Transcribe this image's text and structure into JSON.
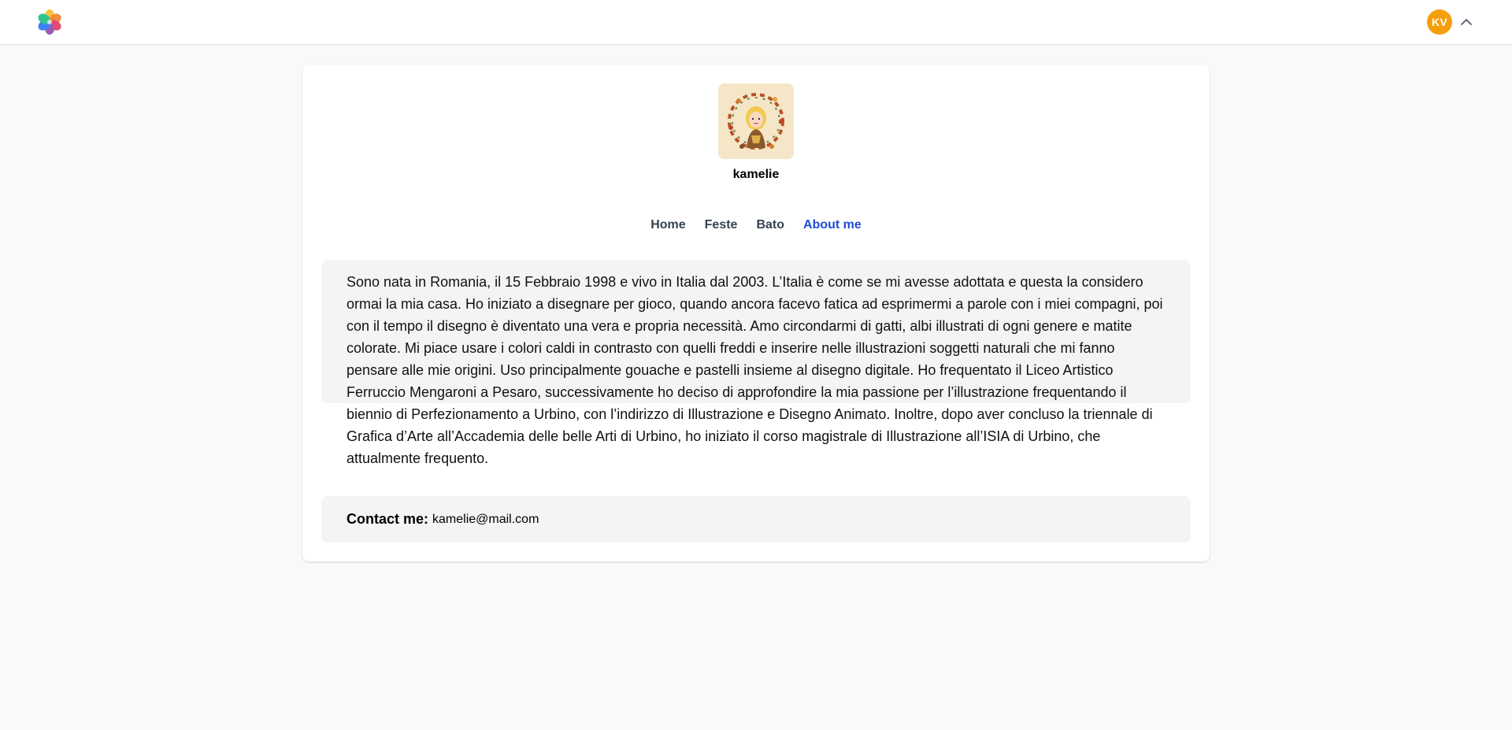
{
  "header": {
    "logo_icon": "flower-pinwheel-logo-icon",
    "avatar_initials": "KV",
    "menu_icon": "chevron-up-icon",
    "avatar_color": "#f59e0b"
  },
  "profile": {
    "picture": "profile-illustration-icon",
    "username": "kamelie"
  },
  "tabs": [
    {
      "label": "Home",
      "active": false
    },
    {
      "label": "Feste",
      "active": false
    },
    {
      "label": "Bato",
      "active": false
    },
    {
      "label": "About me",
      "active": true
    }
  ],
  "about": {
    "bio": "Sono nata in Romania, il 15 Febbraio 1998 e vivo in Italia dal 2003. L’Italia è come se mi avesse adottata e questa la considero ormai la mia casa. Ho iniziato a disegnare per gioco, quando ancora facevo fatica ad esprimermi a parole con i miei compagni, poi con il tempo il disegno è diventato una vera e propria necessità. Amo circondarmi di gatti, albi illustrati di ogni genere e matite colorate. Mi piace usare i colori caldi in contrasto con quelli freddi e inserire nelle illustrazioni soggetti naturali che mi fanno pensare alle mie origini. Uso principalmente gouache e pastelli insieme al disegno digitale. Ho frequentato il Liceo Artistico Ferruccio Mengaroni a Pesaro, successivamente ho deciso di approfondire la mia passione per l’illustrazione frequentando il biennio di Perfezionamento a Urbino, con l’indirizzo di Illustrazione e Disegno Animato. Inoltre, dopo aver concluso la triennale di Grafica d’Arte all’Accademia delle belle Arti di Urbino, ho iniziato il corso magistrale di Illustrazione all’ISIA di Urbino, che attualmente frequento.",
    "contact_label": "Contact me:",
    "contact_email": "kamelie@mail.com"
  },
  "colors": {
    "accent": "#1d4ed8",
    "panel_bg": "#f3f4f6",
    "page_bg": "#f8f9fb"
  }
}
